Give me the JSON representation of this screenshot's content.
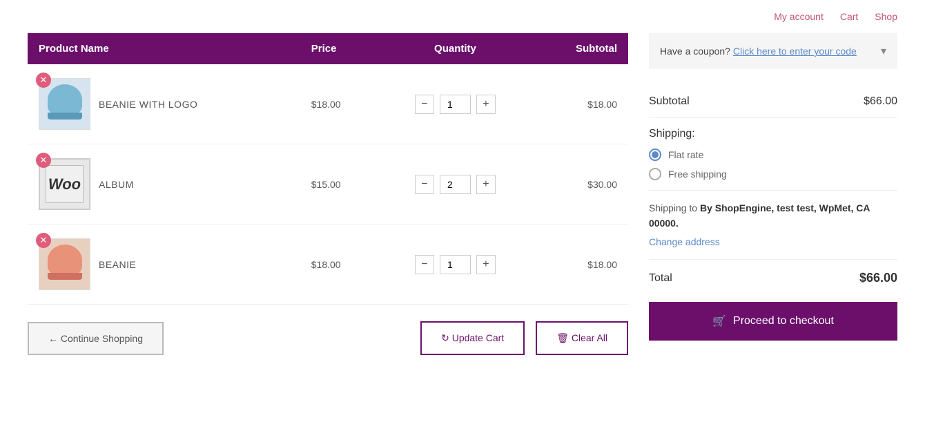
{
  "nav": {
    "my_account": "My account",
    "cart": "Cart",
    "shop": "Shop"
  },
  "table": {
    "col_product": "Product Name",
    "col_price": "Price",
    "col_quantity": "Quantity",
    "col_subtotal": "Subtotal"
  },
  "products": [
    {
      "id": "beanie-with-logo",
      "name": "BEANIE WITH LOGO",
      "price": "$18.00",
      "quantity": 1,
      "subtotal": "$18.00",
      "img_type": "beanie-logo"
    },
    {
      "id": "album",
      "name": "ALBUM",
      "price": "$15.00",
      "quantity": 2,
      "subtotal": "$30.00",
      "img_type": "album"
    },
    {
      "id": "beanie",
      "name": "BEANIE",
      "price": "$18.00",
      "quantity": 1,
      "subtotal": "$18.00",
      "img_type": "beanie"
    }
  ],
  "actions": {
    "continue_shopping": "← Continue Shopping",
    "update_cart": "↻ Update Cart",
    "clear_all": "🗑 Clear All"
  },
  "coupon": {
    "text": "Have a coupon?",
    "link": "Click here to enter your code"
  },
  "summary": {
    "subtotal_label": "Subtotal",
    "subtotal_value": "$66.00",
    "shipping_label": "Shipping:",
    "flat_rate": "Flat rate",
    "free_shipping": "Free shipping",
    "shipping_to_prefix": "Shipping to",
    "shipping_address": "By ShopEngine, test test, WpMet, CA 00000.",
    "change_address": "Change address",
    "total_label": "Total",
    "total_value": "$66.00",
    "checkout_btn": "Proceed to checkout"
  },
  "colors": {
    "header_bg": "#6b0f6b",
    "checkout_bg": "#6b0f6b",
    "remove_bg": "#e05c7a",
    "link_color": "#5b8ac9",
    "nav_color": "#c0556a"
  }
}
